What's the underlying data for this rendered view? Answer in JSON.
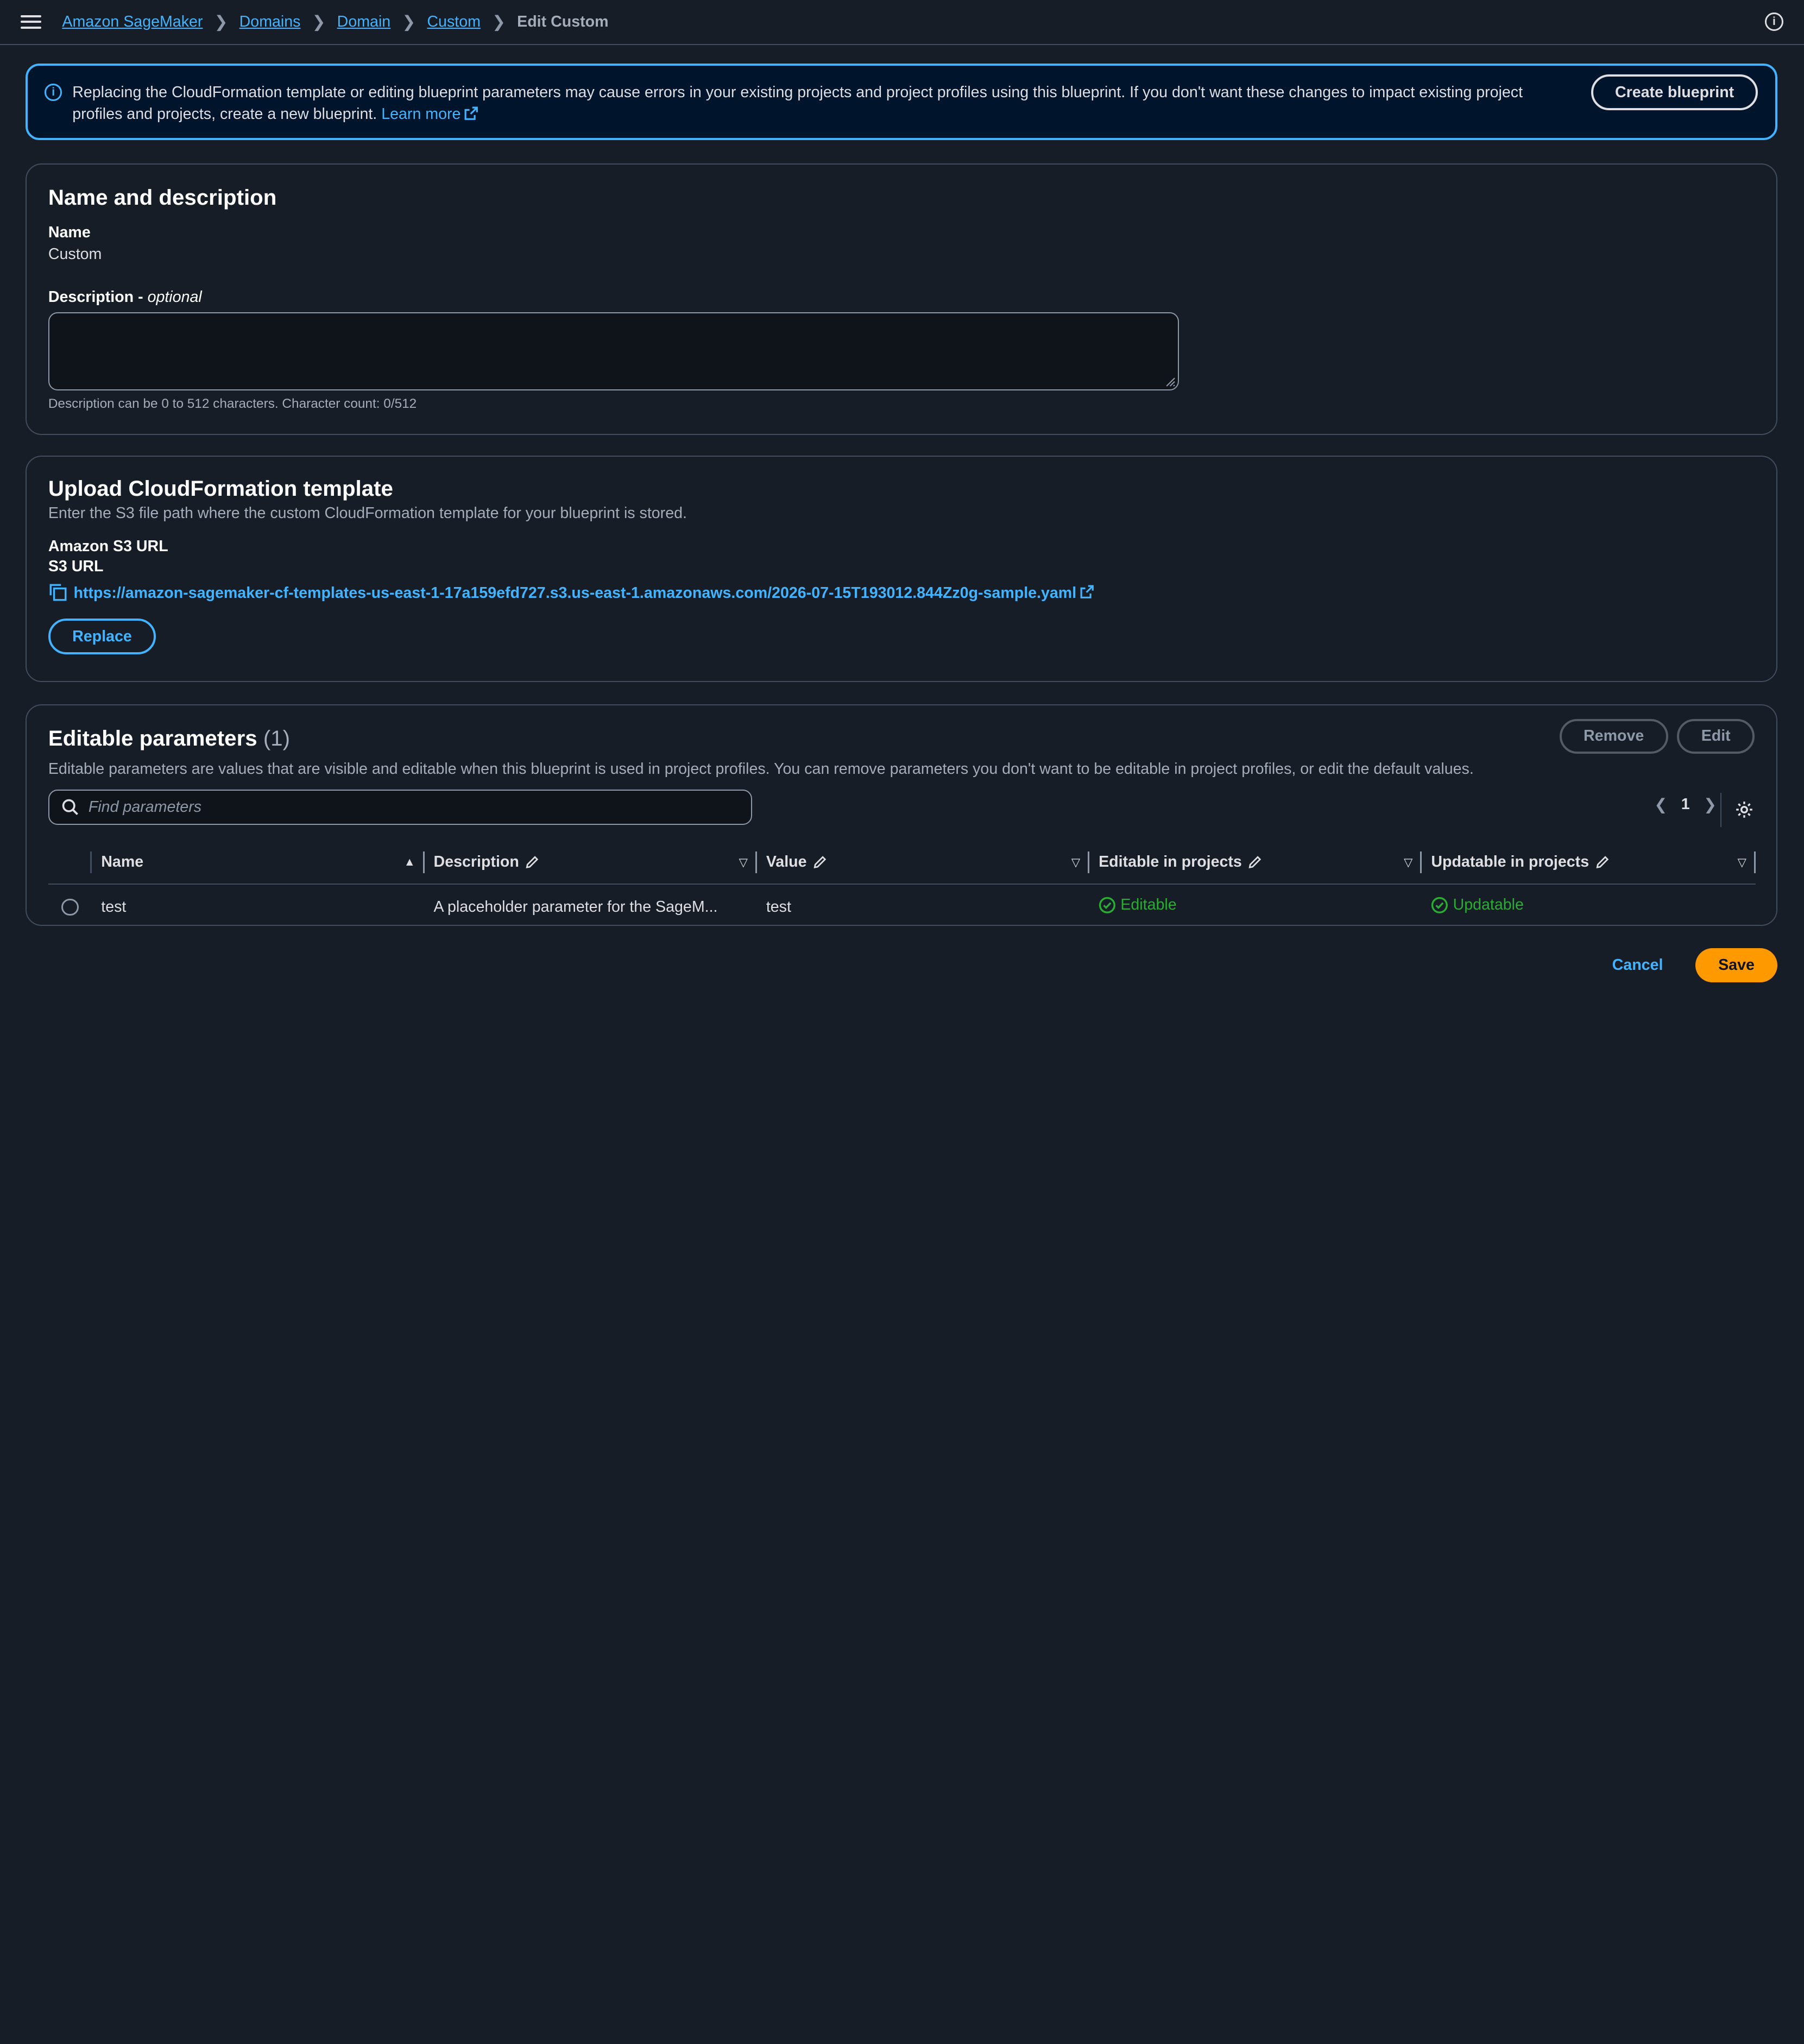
{
  "breadcrumbs": {
    "items": [
      "Amazon SageMaker",
      "Domains",
      "Domain",
      "Custom"
    ],
    "current": "Edit Custom"
  },
  "alert": {
    "text": "Replacing the CloudFormation template or editing blueprint parameters may cause errors in your existing projects and project profiles using this blueprint. If you don't want these changes to impact existing project profiles and projects, create a new blueprint.",
    "learn_more": "Learn more",
    "button": "Create blueprint"
  },
  "name_section": {
    "title": "Name and description",
    "name_label": "Name",
    "name_value": "Custom",
    "description_label": "Description - ",
    "description_optional": "optional",
    "description_value": "",
    "description_hint": "Description can be 0 to 512 characters. Character count: 0/512"
  },
  "upload_section": {
    "title": "Upload CloudFormation template",
    "subtitle": "Enter the S3 file path where the custom CloudFormation template for your blueprint is stored.",
    "s3_heading": "Amazon S3 URL",
    "s3_label": "S3 URL",
    "s3_url": "https://amazon-sagemaker-cf-templates-us-east-1-17a159efd727.s3.us-east-1.amazonaws.com/2026-07-15T193012.844Zz0g-sample.yaml",
    "replace_button": "Replace"
  },
  "params_section": {
    "title": "Editable parameters",
    "count": "(1)",
    "remove_button": "Remove",
    "edit_button": "Edit",
    "description": "Editable parameters are values that are visible and editable when this blueprint is used in project profiles. You can remove parameters you don't want to be editable in project profiles, or edit the default values.",
    "search_placeholder": "Find parameters",
    "page": "1",
    "columns": [
      "Name",
      "Description",
      "Value",
      "Editable in projects",
      "Updatable in projects"
    ],
    "rows": [
      {
        "name": "test",
        "description": "A placeholder parameter for the SageM...",
        "value": "test",
        "editable": "Editable",
        "updatable": "Updatable"
      }
    ]
  },
  "footer": {
    "cancel": "Cancel",
    "save": "Save"
  },
  "colors": {
    "accent": "#42b4ff",
    "primary": "#ff9900",
    "success": "#29ad32",
    "background": "#161d26"
  }
}
